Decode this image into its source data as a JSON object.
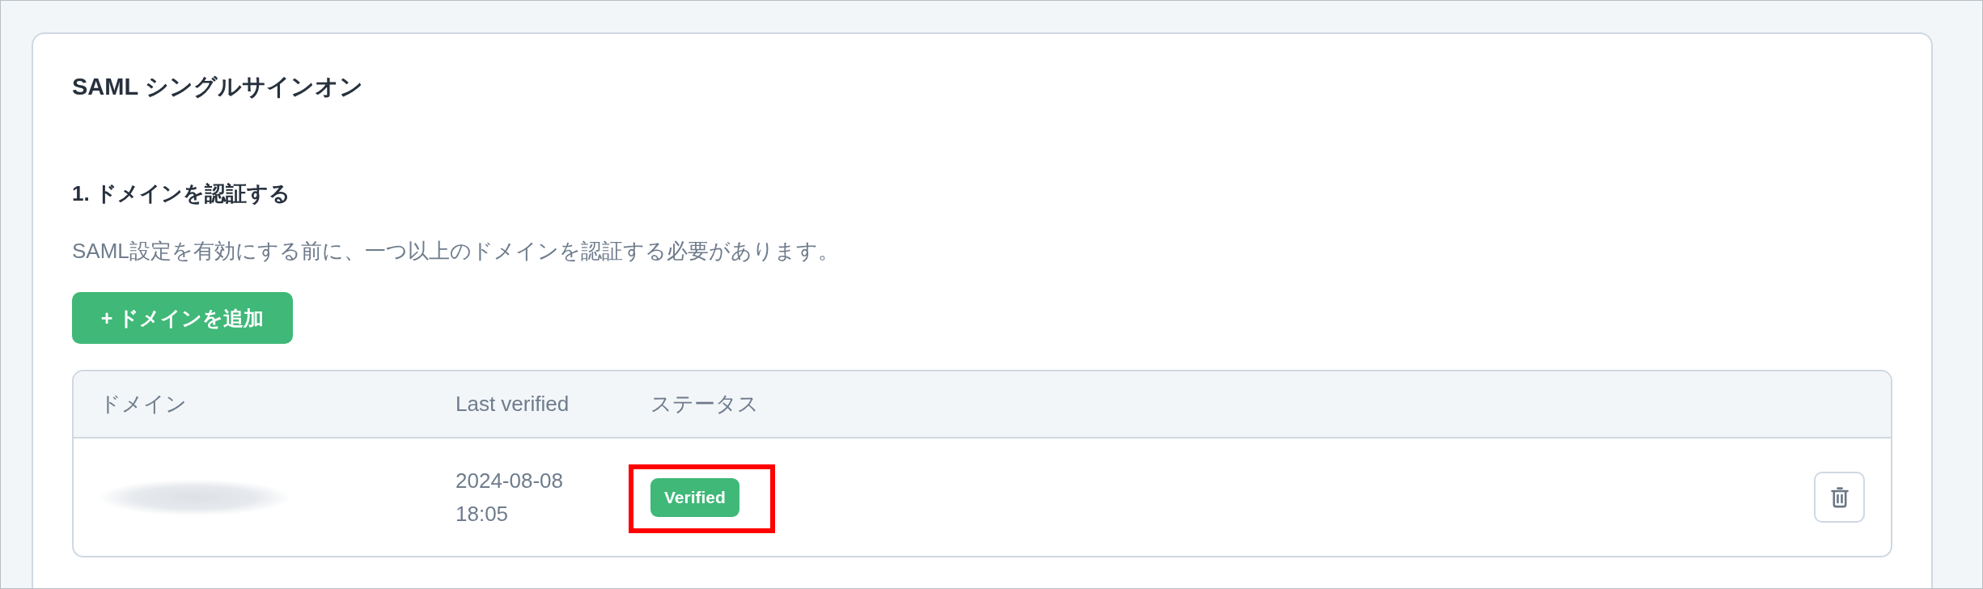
{
  "card": {
    "title": "SAML シングルサインオン"
  },
  "section": {
    "heading": "1. ドメインを認証する",
    "description": "SAML設定を有効にする前に、一つ以上のドメインを認証する必要があります。",
    "add_button": "+ ドメインを追加"
  },
  "table": {
    "columns": [
      "ドメイン",
      "Last verified",
      "ステータス"
    ],
    "rows": [
      {
        "domain_blurred": true,
        "last_verified": "2024-08-08 18:05",
        "status": {
          "label": "Verified",
          "kind": "verified",
          "highlighted": true
        }
      }
    ]
  }
}
